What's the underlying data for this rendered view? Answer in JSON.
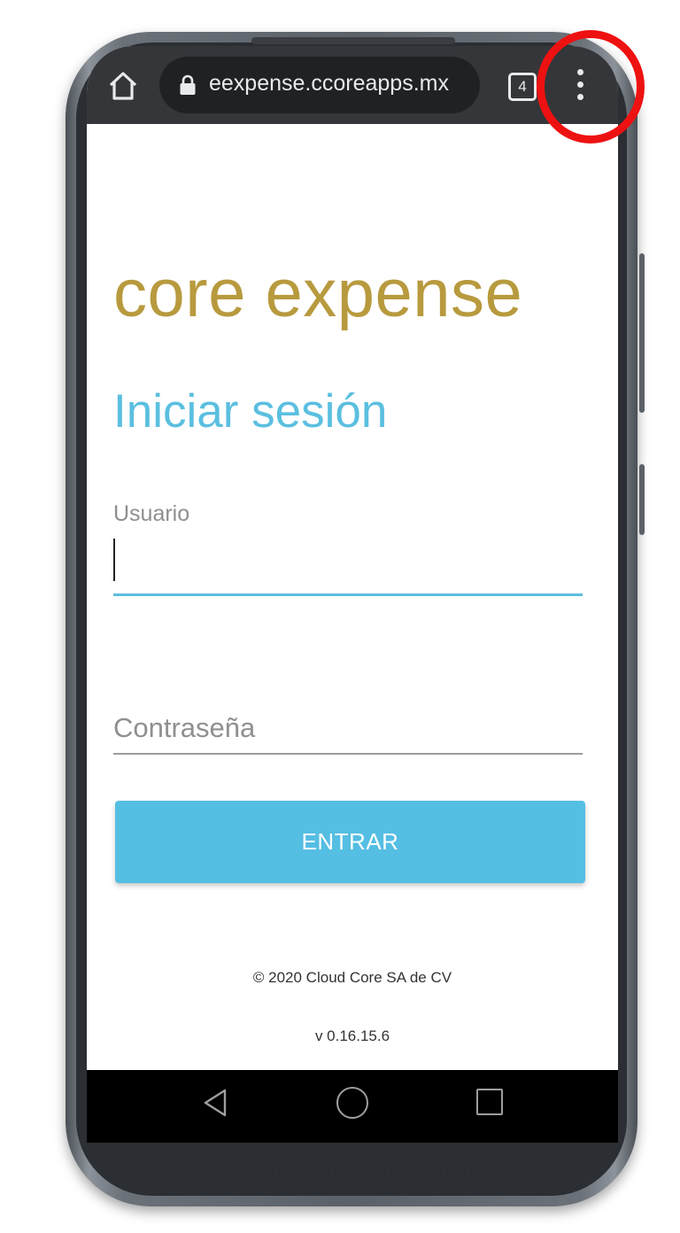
{
  "browser": {
    "url": "eexpense.ccoreapps.mx",
    "tab_count": "4"
  },
  "app": {
    "brand": "core expense",
    "title": "Iniciar sesión",
    "username_label": "Usuario",
    "username_value": "",
    "password_placeholder": "Contraseña",
    "submit_label": "ENTRAR",
    "copyright": "© 2020 Cloud Core SA de CV",
    "version": "v 0.16.15.6"
  },
  "colors": {
    "brand_gold": "#b89a3e",
    "accent_blue": "#5bbfe0",
    "button_blue": "#55bee3",
    "highlight_red": "#ee1111",
    "browser_bar": "#35363a"
  },
  "icons": {
    "home": "home-icon",
    "lock": "lock-icon",
    "tabs": "tab-switcher-icon",
    "menu": "more-vert-icon",
    "nav_back": "back-triangle-icon",
    "nav_home": "home-circle-icon",
    "nav_recent": "recents-square-icon"
  }
}
